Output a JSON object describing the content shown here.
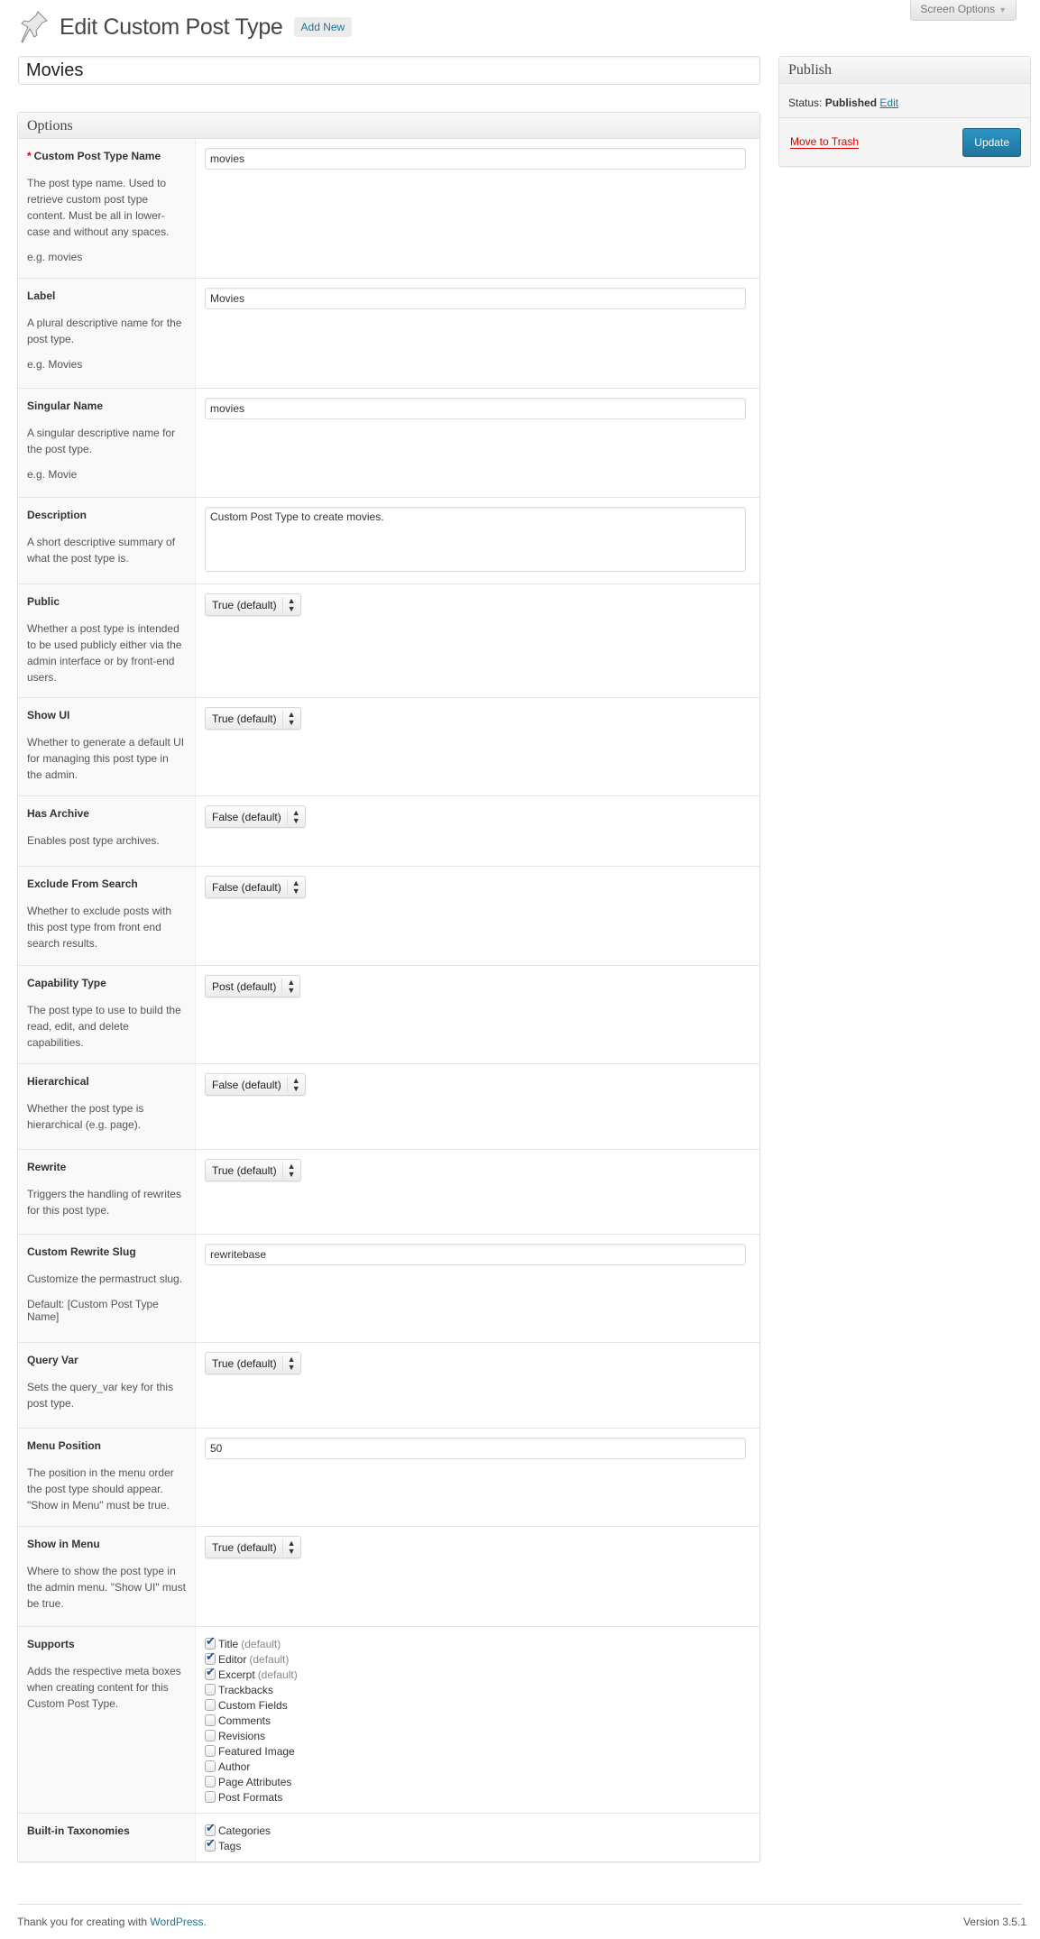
{
  "header": {
    "title": "Edit Custom Post Type",
    "add_new": "Add New",
    "screen_options": "Screen Options"
  },
  "post_title": "Movies",
  "options": {
    "heading": "Options",
    "rows": [
      {
        "name": "Custom Post Type Name",
        "required": true,
        "desc": "The post type name. Used to retrieve custom post type content. Must be all in lower-case and without any spaces.",
        "eg": "e.g. movies",
        "type": "text",
        "value": "movies"
      },
      {
        "name": "Label",
        "desc": "A plural descriptive name for the post type.",
        "eg": "e.g. Movies",
        "type": "text",
        "value": "Movies"
      },
      {
        "name": "Singular Name",
        "desc": "A singular descriptive name for the post type.",
        "eg": "e.g. Movie",
        "type": "text",
        "value": "movies"
      },
      {
        "name": "Description",
        "desc": "A short descriptive summary of what the post type is.",
        "type": "textarea",
        "value": "Custom Post Type to create movies."
      },
      {
        "name": "Public",
        "desc": "Whether a post type is intended to be used publicly either via the admin interface or by front-end users.",
        "type": "select",
        "value": "True (default)"
      },
      {
        "name": "Show UI",
        "desc": "Whether to generate a default UI for managing this post type in the admin.",
        "type": "select",
        "value": "True (default)"
      },
      {
        "name": "Has Archive",
        "desc": "Enables post type archives.",
        "type": "select",
        "value": "False (default)"
      },
      {
        "name": "Exclude From Search",
        "desc": "Whether to exclude posts with this post type from front end search results.",
        "type": "select",
        "value": "False (default)"
      },
      {
        "name": "Capability Type",
        "desc": "The post type to use to build the read, edit, and delete capabilities.",
        "type": "select",
        "value": "Post (default)"
      },
      {
        "name": "Hierarchical",
        "desc": "Whether the post type is hierarchical (e.g. page).",
        "type": "select",
        "value": "False (default)"
      },
      {
        "name": "Rewrite",
        "desc": "Triggers the handling of rewrites for this post type.",
        "type": "select",
        "value": "True (default)"
      },
      {
        "name": "Custom Rewrite Slug",
        "desc": "Customize the permastruct slug.",
        "eg": "Default: [Custom Post Type Name]",
        "type": "text",
        "value": "rewritebase"
      },
      {
        "name": "Query Var",
        "desc": "Sets the query_var key for this post type.",
        "type": "select",
        "value": "True (default)"
      },
      {
        "name": "Menu Position",
        "desc": "The position in the menu order the post type should appear. \"Show in Menu\" must be true.",
        "type": "text",
        "value": "50"
      },
      {
        "name": "Show in Menu",
        "desc": "Where to show the post type in the admin menu. \"Show UI\" must be true.",
        "type": "select",
        "value": "True (default)"
      },
      {
        "name": "Supports",
        "desc": "Adds the respective meta boxes when creating content for this Custom Post Type.",
        "type": "checkboxes",
        "options": [
          {
            "label": "Title",
            "extra": "(default)",
            "checked": true
          },
          {
            "label": "Editor",
            "extra": "(default)",
            "checked": true
          },
          {
            "label": "Excerpt",
            "extra": "(default)",
            "checked": true
          },
          {
            "label": "Trackbacks",
            "checked": false
          },
          {
            "label": "Custom Fields",
            "checked": false
          },
          {
            "label": "Comments",
            "checked": false
          },
          {
            "label": "Revisions",
            "checked": false
          },
          {
            "label": "Featured Image",
            "checked": false
          },
          {
            "label": "Author",
            "checked": false
          },
          {
            "label": "Page Attributes",
            "checked": false
          },
          {
            "label": "Post Formats",
            "checked": false
          }
        ]
      },
      {
        "name": "Built-in Taxonomies",
        "type": "checkboxes",
        "options": [
          {
            "label": "Categories",
            "checked": true
          },
          {
            "label": "Tags",
            "checked": true
          }
        ]
      }
    ]
  },
  "publish": {
    "heading": "Publish",
    "status_label": "Status:",
    "status_value": "Published",
    "edit": "Edit",
    "trash": "Move to Trash",
    "update": "Update"
  },
  "footer": {
    "thanks": "Thank you for creating with",
    "wp_link": "WordPress.",
    "version": "Version 3.5.1"
  },
  "colors": {
    "link": "#21759b",
    "trash": "#dd0000",
    "update_button": "#21759b"
  }
}
